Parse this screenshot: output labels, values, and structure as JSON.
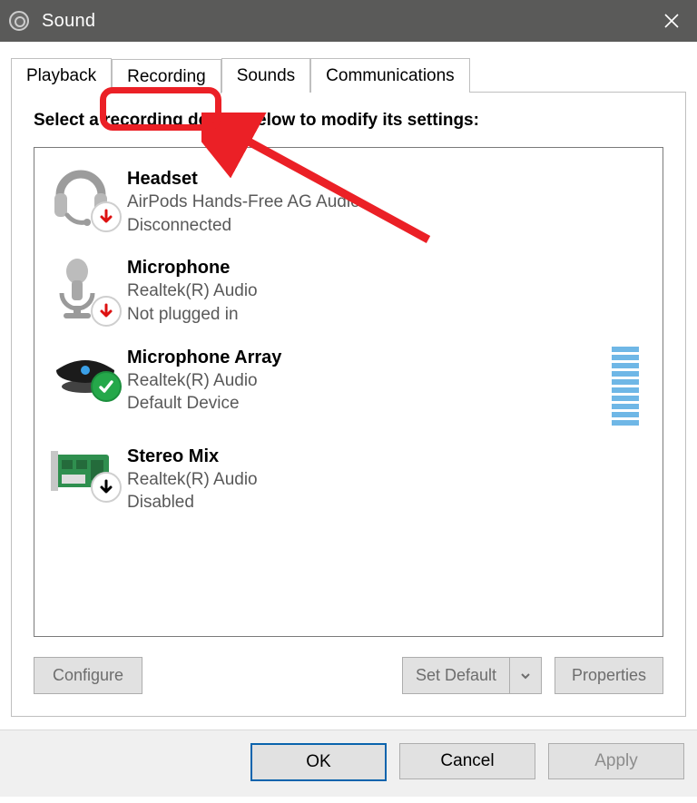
{
  "window": {
    "title": "Sound"
  },
  "tabs": [
    "Playback",
    "Recording",
    "Sounds",
    "Communications"
  ],
  "active_tab_index": 1,
  "instruction": "Select a recording device below to modify its settings:",
  "devices": [
    {
      "name": "Headset",
      "desc": "AirPods Hands-Free AG Audio",
      "status": "Disconnected",
      "badge": "down-red",
      "icon": "headset"
    },
    {
      "name": "Microphone",
      "desc": "Realtek(R) Audio",
      "status": "Not plugged in",
      "badge": "down-red",
      "icon": "microphone"
    },
    {
      "name": "Microphone Array",
      "desc": "Realtek(R) Audio",
      "status": "Default Device",
      "badge": "check",
      "icon": "mic-array",
      "level": true
    },
    {
      "name": "Stereo Mix",
      "desc": "Realtek(R) Audio",
      "status": "Disabled",
      "badge": "down-black",
      "icon": "sound-card"
    }
  ],
  "buttons": {
    "configure": "Configure",
    "set_default": "Set Default",
    "properties": "Properties",
    "ok": "OK",
    "cancel": "Cancel",
    "apply": "Apply"
  }
}
